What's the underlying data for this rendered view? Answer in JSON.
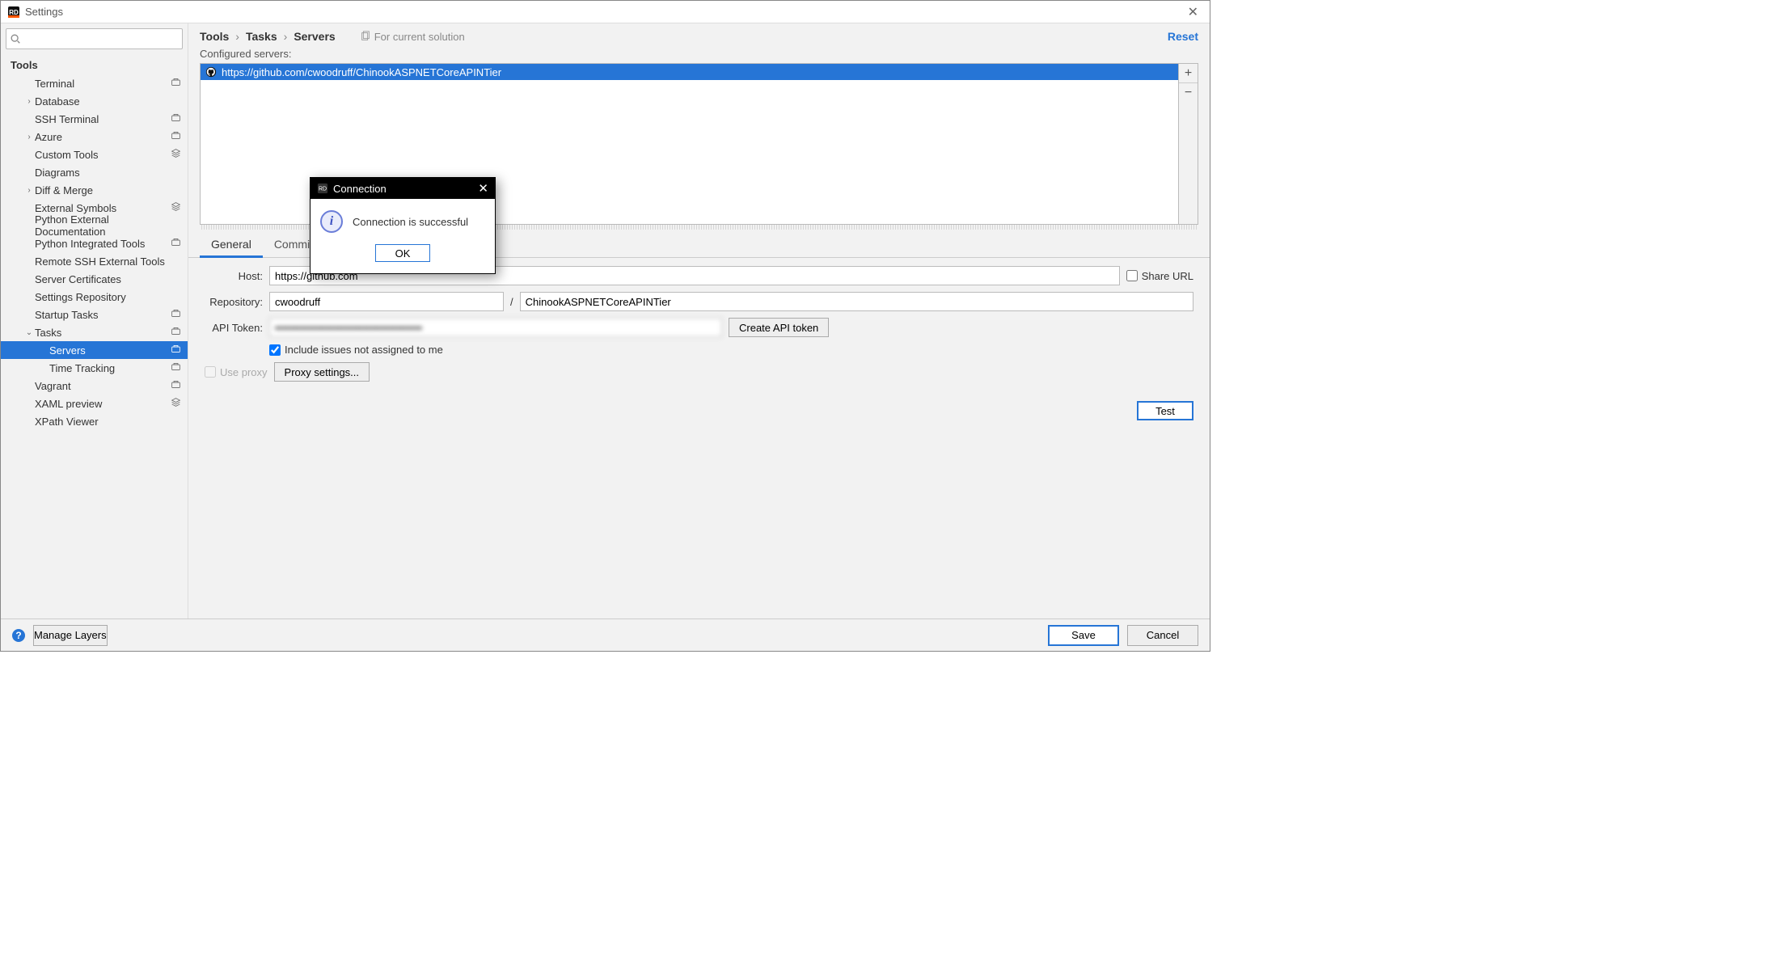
{
  "window": {
    "title": "Settings"
  },
  "search": {
    "placeholder": ""
  },
  "sidebar": {
    "header": "Tools",
    "items": [
      {
        "label": "Terminal",
        "indent": 1,
        "arrow": "",
        "badge": "briefcase"
      },
      {
        "label": "Database",
        "indent": 1,
        "arrow": "›",
        "badge": ""
      },
      {
        "label": "SSH Terminal",
        "indent": 1,
        "arrow": "",
        "badge": "briefcase"
      },
      {
        "label": "Azure",
        "indent": 1,
        "arrow": "›",
        "badge": "briefcase"
      },
      {
        "label": "Custom Tools",
        "indent": 1,
        "arrow": "",
        "badge": "stack"
      },
      {
        "label": "Diagrams",
        "indent": 1,
        "arrow": "",
        "badge": ""
      },
      {
        "label": "Diff & Merge",
        "indent": 1,
        "arrow": "›",
        "badge": ""
      },
      {
        "label": "External Symbols",
        "indent": 1,
        "arrow": "",
        "badge": "stack"
      },
      {
        "label": "Python External Documentation",
        "indent": 1,
        "arrow": "",
        "badge": ""
      },
      {
        "label": "Python Integrated Tools",
        "indent": 1,
        "arrow": "",
        "badge": "briefcase"
      },
      {
        "label": "Remote SSH External Tools",
        "indent": 1,
        "arrow": "",
        "badge": ""
      },
      {
        "label": "Server Certificates",
        "indent": 1,
        "arrow": "",
        "badge": ""
      },
      {
        "label": "Settings Repository",
        "indent": 1,
        "arrow": "",
        "badge": ""
      },
      {
        "label": "Startup Tasks",
        "indent": 1,
        "arrow": "",
        "badge": "briefcase"
      },
      {
        "label": "Tasks",
        "indent": 1,
        "arrow": "⌄",
        "badge": "briefcase"
      },
      {
        "label": "Servers",
        "indent": 2,
        "arrow": "",
        "badge": "briefcase",
        "selected": true
      },
      {
        "label": "Time Tracking",
        "indent": 2,
        "arrow": "",
        "badge": "briefcase"
      },
      {
        "label": "Vagrant",
        "indent": 1,
        "arrow": "",
        "badge": "briefcase"
      },
      {
        "label": "XAML preview",
        "indent": 1,
        "arrow": "",
        "badge": "stack"
      },
      {
        "label": "XPath Viewer",
        "indent": 1,
        "arrow": "",
        "badge": ""
      }
    ]
  },
  "breadcrumb": {
    "p1": "Tools",
    "p2": "Tasks",
    "p3": "Servers",
    "solution": "For current solution",
    "reset": "Reset"
  },
  "servers": {
    "label": "Configured servers:",
    "items": [
      {
        "url": "https://github.com/cwoodruff/ChinookASPNETCoreAPINTier"
      }
    ],
    "addTip": "+",
    "removeTip": "−"
  },
  "tabs": {
    "general": "General",
    "commit": "Commit Message"
  },
  "form": {
    "hostLabel": "Host:",
    "hostValue": "https://github.com",
    "shareUrl": "Share URL",
    "repoLabel": "Repository:",
    "repoOwner": "cwoodruff",
    "repoSep": "/",
    "repoName": "ChinookASPNETCoreAPINTier",
    "tokenLabel": "API Token:",
    "tokenValue": "••••••••••••••••••••••••••••••••••••••••",
    "createToken": "Create API token",
    "includeIssues": "Include issues not assigned to me",
    "useProxy": "Use proxy",
    "proxySettings": "Proxy settings...",
    "test": "Test"
  },
  "footer": {
    "manageLayers": "Manage Layers",
    "save": "Save",
    "cancel": "Cancel"
  },
  "dialog": {
    "title": "Connection",
    "message": "Connection is successful",
    "ok": "OK"
  }
}
